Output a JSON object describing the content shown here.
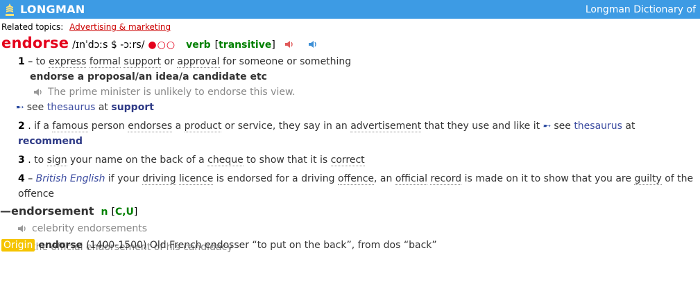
{
  "header": {
    "brand": "LONGMAN",
    "title_right": "Longman Dictionary of"
  },
  "topics": {
    "label": "Related topics:",
    "link": "Advertising & marketing"
  },
  "entry": {
    "headword": "endorse",
    "pron": "/ɪnˈdɔːs $ -ɔːrs/",
    "freq": "●○○",
    "pos": "verb",
    "gram_open": "[",
    "gram_word": "transitive",
    "gram_close": "]"
  },
  "sense1": {
    "num": "1",
    "sep": " – ",
    "w_to": "to",
    "w_express": "express",
    "w_formal": "formal",
    "w_support": "support",
    "w_or": "or",
    "w_approval": "approval",
    "w_rest": "for someone or something",
    "collocation": "endorse a proposal/an idea/a candidate etc",
    "example": "The prime minister is unlikely to endorse this view."
  },
  "thes1": {
    "see": "see",
    "thesaurus": "thesaurus",
    "at": "at",
    "target": "support"
  },
  "sense2": {
    "num": "2",
    "sep": " . ",
    "t1": "if a",
    "w_famous": "famous",
    "t2": "person",
    "w_endorses": "endorses",
    "t3": "a",
    "w_product": "product",
    "t4": "or service, they say in an",
    "w_advertisement": "advertisement",
    "t5": "that they use and like it",
    "see": "see",
    "thesaurus": "thesaurus",
    "at": "at",
    "target": "recommend"
  },
  "sense3": {
    "num": "3",
    "sep": " . ",
    "t1": "to",
    "w_sign": "sign",
    "t2": "your name on the back of a",
    "w_cheque": "cheque",
    "t3": "to show that it is",
    "w_correct": "correct"
  },
  "sense4": {
    "num": "4",
    "sep": " – ",
    "geo": "British English",
    "t1": "if your",
    "w_driving": "driving",
    "w_licence": "licence",
    "t2": "is endorsed for a driving",
    "w_offence": "offence",
    "t3": ", an",
    "w_official": "official",
    "w_record": "record",
    "t4": "is made on it to show that you are",
    "w_guilty": "guilty",
    "t5": "of the offence"
  },
  "derivative": {
    "dash": "—",
    "headword": "endorsement",
    "pos": "n",
    "gram_open": "[",
    "gram_word": "C,U",
    "gram_close": "]",
    "example1": "celebrity endorsements",
    "example2": "the official endorsement of his candidacy"
  },
  "origin": {
    "label": "Origin",
    "headword": "endorse",
    "text": "(1400-1500) Old French endosser “to put on the back”, from dos “back”"
  },
  "colors": {
    "header_bg": "#3d9be4",
    "headword": "#e4001b",
    "pos": "#008000",
    "link_blue": "#3b4ba0",
    "origin_badge": "#f5c400"
  }
}
